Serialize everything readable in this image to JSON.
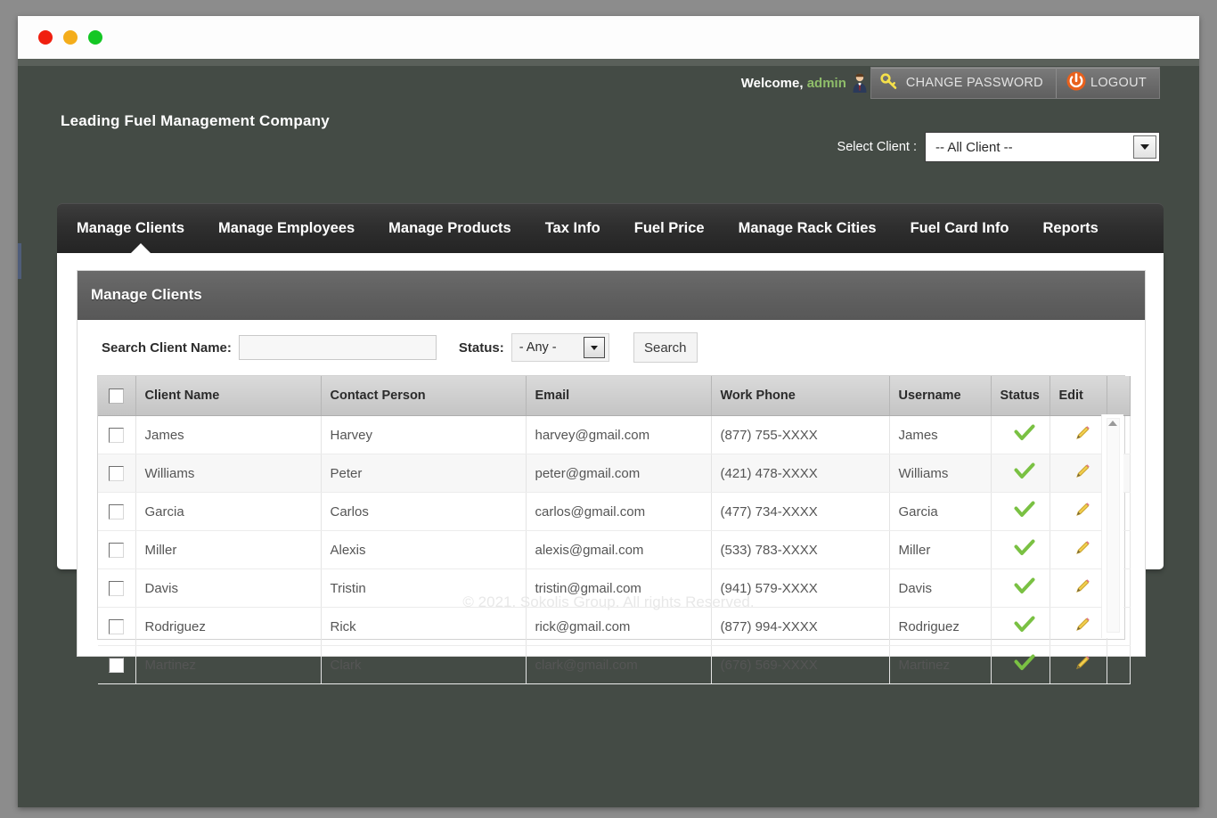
{
  "window": {
    "traffic_lights": [
      "close-red",
      "minimize-yellow",
      "maximize-green"
    ]
  },
  "header": {
    "welcome_prefix": "Welcome,",
    "welcome_user": "admin",
    "user_icon": "user-avatar-icon",
    "change_password_label": "CHANGE PASSWORD",
    "change_password_icon": "key-icon",
    "logout_label": "LOGOUT",
    "logout_icon": "power-icon",
    "brand_title": "Leading Fuel Management Company",
    "select_client_label": "Select Client :",
    "select_client_value": "-- All Client --",
    "select_client_caret": "chevron-down-icon"
  },
  "nav": {
    "tabs": [
      {
        "label": "Manage Clients",
        "active": true
      },
      {
        "label": "Manage Employees",
        "active": false
      },
      {
        "label": "Manage Products",
        "active": false
      },
      {
        "label": "Tax Info",
        "active": false
      },
      {
        "label": "Fuel Price",
        "active": false
      },
      {
        "label": "Manage Rack Cities",
        "active": false
      },
      {
        "label": "Fuel Card Info",
        "active": false
      },
      {
        "label": "Reports",
        "active": false
      }
    ]
  },
  "panel": {
    "title": "Manage Clients",
    "search": {
      "client_name_label": "Search Client Name:",
      "client_name_value": "",
      "client_name_placeholder": "",
      "status_label": "Status:",
      "status_value": "- Any -",
      "status_caret": "chevron-down-icon",
      "search_button_label": "Search"
    },
    "table": {
      "select_all_checkbox": "select-all-checkbox",
      "columns": [
        "",
        "Client Name",
        "Contact Person",
        "Email",
        "Work Phone",
        "Username",
        "Status",
        "Edit"
      ],
      "status_icon": "green-check-icon",
      "edit_icon": "pencil-icon",
      "rows": [
        {
          "client_name": "James",
          "contact_person": "Harvey",
          "email": "harvey@gmail.com",
          "work_phone": "(877) 755-XXXX",
          "username": "James",
          "status": "active",
          "edit": "edit"
        },
        {
          "client_name": "Williams",
          "contact_person": "Peter",
          "email": "peter@gmail.com",
          "work_phone": "(421) 478-XXXX",
          "username": "Williams",
          "status": "active",
          "edit": "edit"
        },
        {
          "client_name": "Garcia",
          "contact_person": "Carlos",
          "email": "carlos@gmail.com",
          "work_phone": "(477) 734-XXXX",
          "username": "Garcia",
          "status": "active",
          "edit": "edit"
        },
        {
          "client_name": "Miller",
          "contact_person": "Alexis",
          "email": "alexis@gmail.com",
          "work_phone": "(533) 783-XXXX",
          "username": "Miller",
          "status": "active",
          "edit": "edit"
        },
        {
          "client_name": "Davis",
          "contact_person": "Tristin",
          "email": "tristin@gmail.com",
          "work_phone": "(941) 579-XXXX",
          "username": "Davis",
          "status": "active",
          "edit": "edit"
        },
        {
          "client_name": "Rodriguez",
          "contact_person": "Rick",
          "email": "rick@gmail.com",
          "work_phone": "(877) 994-XXXX",
          "username": "Rodriguez",
          "status": "active",
          "edit": "edit"
        },
        {
          "client_name": "Martinez",
          "contact_person": "Clark",
          "email": "clark@gmail.com",
          "work_phone": "(676) 569-XXXX",
          "username": "Martinez",
          "status": "active",
          "edit": "edit"
        }
      ]
    }
  },
  "footer": {
    "copyright": "© 2021. Sokolis Group. All rights Reserved."
  },
  "colors": {
    "page_background": "#8c8c8c",
    "app_background": "#444b45",
    "nav_background": "#2f2f2f",
    "panel_head": "#5f5f5f",
    "email_link": "#3f7a35",
    "welcome_user": "#8fbe6a",
    "logout_accent": "#e8601c",
    "status_check": "#7ac143",
    "edit_pencil": "#f0c419"
  }
}
